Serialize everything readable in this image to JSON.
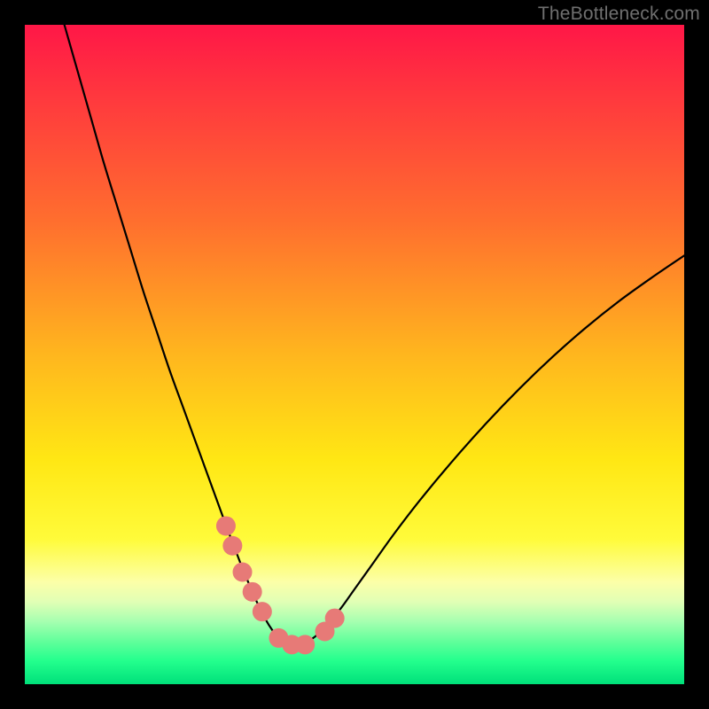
{
  "watermark": {
    "text": "TheBottleneck.com"
  },
  "colors": {
    "frame": "#000000",
    "curve": "#000000",
    "marker": "#e77a77",
    "gradient_stops": [
      {
        "offset": 0.0,
        "color": "#ff1747"
      },
      {
        "offset": 0.12,
        "color": "#ff3b3d"
      },
      {
        "offset": 0.3,
        "color": "#ff6f2e"
      },
      {
        "offset": 0.5,
        "color": "#ffb61e"
      },
      {
        "offset": 0.66,
        "color": "#ffe714"
      },
      {
        "offset": 0.78,
        "color": "#fffb3a"
      },
      {
        "offset": 0.845,
        "color": "#fcffa8"
      },
      {
        "offset": 0.875,
        "color": "#e1ffb5"
      },
      {
        "offset": 0.905,
        "color": "#a6ffb0"
      },
      {
        "offset": 0.935,
        "color": "#61ff9b"
      },
      {
        "offset": 0.965,
        "color": "#23ff8d"
      },
      {
        "offset": 1.0,
        "color": "#00e07a"
      }
    ]
  },
  "chart_data": {
    "type": "line",
    "title": "",
    "xlabel": "",
    "ylabel": "",
    "xlim": [
      0,
      100
    ],
    "ylim": [
      0,
      100
    ],
    "grid": false,
    "legend": false,
    "series": [
      {
        "name": "bottleneck-curve",
        "x": [
          6,
          8,
          10,
          12,
          14,
          16,
          18,
          20,
          22,
          24,
          26,
          28,
          30,
          31,
          32,
          33,
          34,
          35,
          36,
          37,
          38,
          39,
          40,
          41,
          42,
          44,
          46,
          48,
          50,
          53,
          56,
          60,
          65,
          70,
          75,
          80,
          85,
          90,
          95,
          100
        ],
        "y": [
          100,
          93,
          86,
          79,
          72.5,
          66,
          59.5,
          53.5,
          47.5,
          42,
          36.5,
          31,
          25.5,
          22.8,
          20.2,
          17.6,
          15.2,
          12.9,
          10.8,
          9.0,
          7.6,
          6.6,
          6.0,
          5.8,
          6.0,
          7.2,
          9.2,
          11.6,
          14.4,
          18.6,
          22.8,
          28.0,
          34.0,
          39.6,
          44.8,
          49.6,
          54.0,
          58.0,
          61.6,
          65.0
        ]
      }
    ],
    "markers": {
      "name": "highlight-points",
      "x": [
        30.5,
        31.5,
        33.0,
        34.5,
        36.0,
        38.5,
        40.5,
        42.5,
        45.5,
        47.0
      ],
      "y": [
        24.0,
        21.0,
        17.0,
        14.0,
        11.0,
        7.0,
        6.0,
        6.0,
        8.0,
        10.0
      ]
    }
  }
}
